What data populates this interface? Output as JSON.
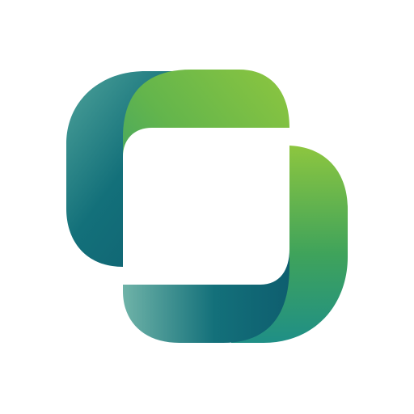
{
  "logo": {
    "icon": "interlocking-rounded-squares-logo",
    "colors": {
      "background": "#ffffff",
      "deep_teal": "#0E5E6F",
      "teal": "#1F8A86",
      "light_teal": "#6FB3A8",
      "green": "#3FA35B",
      "lime": "#8DC63F"
    }
  }
}
